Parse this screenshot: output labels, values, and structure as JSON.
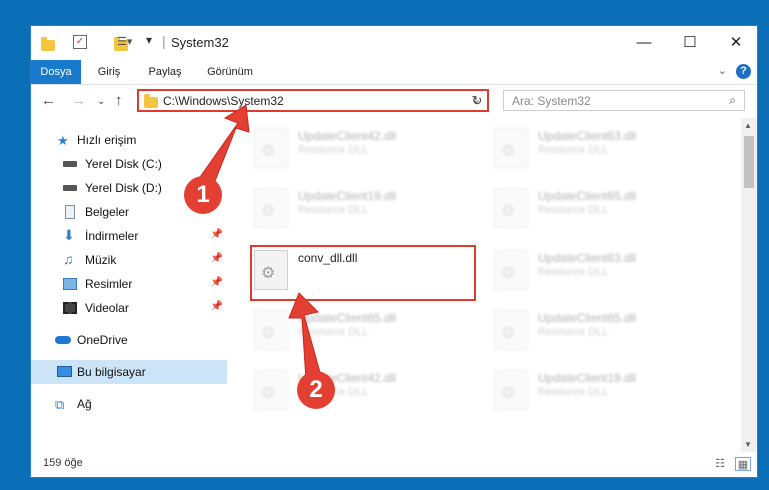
{
  "window": {
    "title": "System32",
    "minimize_icon": "minimize-icon",
    "maximize_icon": "maximize-icon",
    "close_icon": "close-icon"
  },
  "ribbon": {
    "tabs": [
      "Dosya",
      "Giriş",
      "Paylaş",
      "Görünüm"
    ],
    "help_label": "?"
  },
  "nav": {
    "back_icon": "back-arrow-icon",
    "forward_icon": "forward-arrow-icon",
    "up_icon": "up-arrow-icon",
    "address": "C:\\Windows\\System32",
    "search_placeholder": "Ara: System32"
  },
  "sidebar": {
    "items": [
      {
        "label": "Hızlı erişim",
        "icon": "star-icon",
        "pinned": false
      },
      {
        "label": "Yerel Disk (C:)",
        "icon": "drive-icon",
        "pinned": false
      },
      {
        "label": "Yerel Disk (D:)",
        "icon": "drive-icon",
        "pinned": false
      },
      {
        "label": "Belgeler",
        "icon": "documents-icon",
        "pinned": false
      },
      {
        "label": "İndirmeler",
        "icon": "download-icon",
        "pinned": true
      },
      {
        "label": "Müzik",
        "icon": "music-icon",
        "pinned": true
      },
      {
        "label": "Resimler",
        "icon": "pictures-icon",
        "pinned": true
      },
      {
        "label": "Videolar",
        "icon": "video-icon",
        "pinned": true
      },
      {
        "label": "OneDrive",
        "icon": "cloud-icon",
        "pinned": false
      },
      {
        "label": "Bu bilgisayar",
        "icon": "computer-icon",
        "pinned": false
      },
      {
        "label": "Ağ",
        "icon": "network-icon",
        "pinned": false
      }
    ]
  },
  "files": [
    {
      "name": "UpdateClient42.dll",
      "type": "Resource DLL"
    },
    {
      "name": "UpdateClient63.dll",
      "type": "Resource DLL"
    },
    {
      "name": "UpdateClient19.dll",
      "type": "Resource DLL"
    },
    {
      "name": "UpdateClient65.dll",
      "type": "Resource DLL"
    },
    {
      "name": "conv_dll.dll",
      "type": ""
    },
    {
      "name": "UpdateClient63.dll",
      "type": "Resource DLL"
    },
    {
      "name": "UpdateClient65.dll",
      "type": "Resource DLL"
    },
    {
      "name": "UpdateClient65.dll",
      "type": "Resource DLL"
    },
    {
      "name": "UpdateClient42.dll",
      "type": "Resource DLL"
    },
    {
      "name": "UpdateClient19.dll",
      "type": "Resource DLL"
    }
  ],
  "status": {
    "count": "159 öğe"
  },
  "annotations": {
    "badge1": "1",
    "badge2": "2",
    "color": "#e43f33"
  }
}
